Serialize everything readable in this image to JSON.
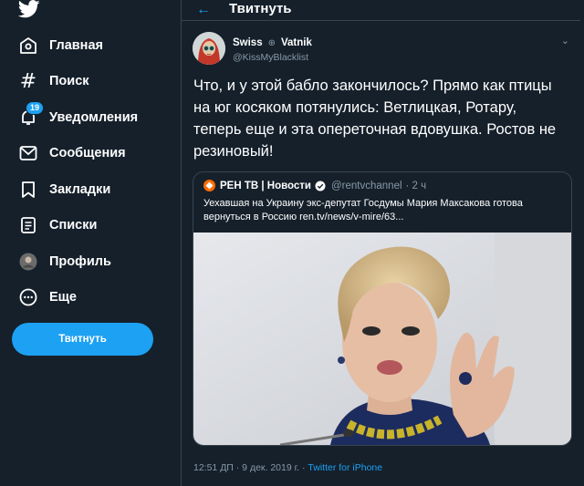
{
  "nav": {
    "items": [
      {
        "label": "Главная",
        "icon": "home-icon"
      },
      {
        "label": "Поиск",
        "icon": "hashtag-icon"
      },
      {
        "label": "Уведомления",
        "icon": "bell-icon",
        "badge": "19"
      },
      {
        "label": "Сообщения",
        "icon": "envelope-icon"
      },
      {
        "label": "Закладки",
        "icon": "bookmark-icon"
      },
      {
        "label": "Списки",
        "icon": "list-icon"
      },
      {
        "label": "Профиль",
        "icon": "profile-avatar-icon"
      },
      {
        "label": "Еще",
        "icon": "more-icon"
      }
    ],
    "tweet_button": "Твитнуть"
  },
  "header": {
    "title": "Твитнуть"
  },
  "tweet": {
    "author_name_first": "Swiss",
    "author_name_second": "Vatnik",
    "handle": "@KissMyBlacklist",
    "text": "Что, и у этой бабло закончилось? Прямо как птицы на юг косяком потянулись: Ветлицкая, Ротару, теперь еще и эта опереточная вдовушка. Ростов не резиновый!",
    "quoted": {
      "name": "РЕН ТВ | Новости",
      "handle": "@rentvchannel",
      "time": "· 2 ч",
      "text": "Уехавшая на Украину экс-депутат Госдумы Мария Максакова готова вернуться в Россию ren.tv/news/v-mire/63..."
    },
    "timestamp": "12:51 ДП · 9 дек. 2019 г. · ",
    "source": "Twitter for iPhone"
  },
  "colors": {
    "background": "#15202b",
    "accent": "#1da1f2",
    "muted": "#8899a6",
    "border": "#38444d"
  }
}
